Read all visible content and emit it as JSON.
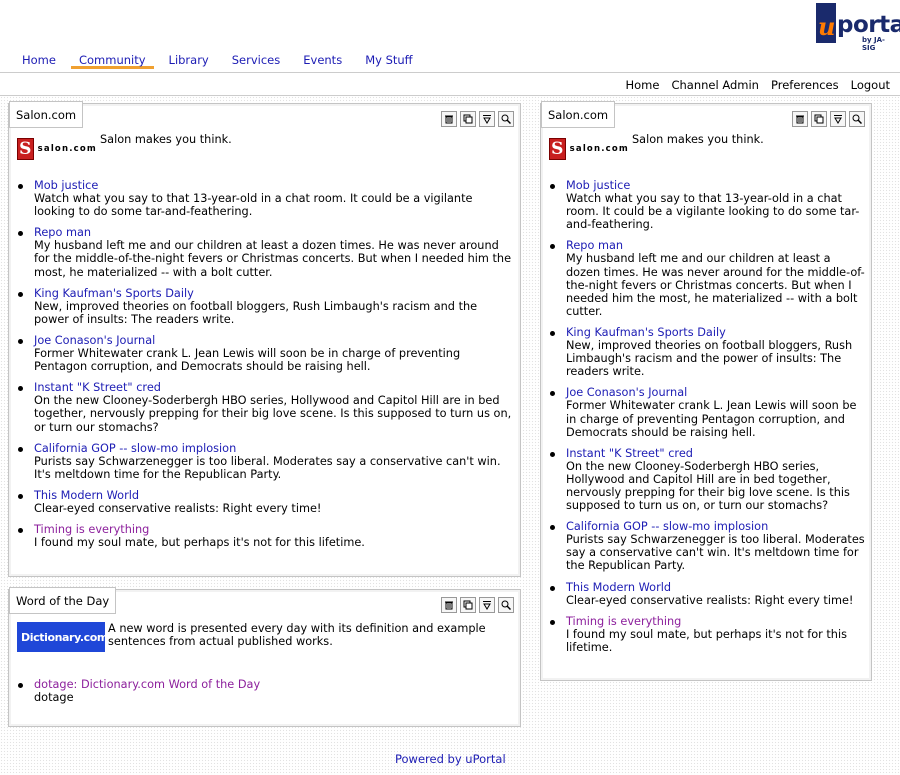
{
  "logo": {
    "u": "u",
    "portal": "portal",
    "byline": "by JA-SIG"
  },
  "tabs": [
    {
      "label": "Home",
      "active": false
    },
    {
      "label": "Community",
      "active": true
    },
    {
      "label": "Library",
      "active": false
    },
    {
      "label": "Services",
      "active": false
    },
    {
      "label": "Events",
      "active": false
    },
    {
      "label": "My Stuff",
      "active": false
    }
  ],
  "subnav": [
    "Home",
    "Channel Admin",
    "Preferences",
    "Logout"
  ],
  "colors": {
    "link": "#1c1cb4",
    "visited": "#8c1f9c",
    "active_tab_underline": "#f0a030"
  },
  "icons": [
    "trash-icon",
    "detach-icon",
    "minimize-icon",
    "zoom-icon"
  ],
  "salon": {
    "title": "Salon.com",
    "logo_text": "salon.com",
    "intro": "Salon makes you think.",
    "items": [
      {
        "title": "Mob justice",
        "desc": "Watch what you say to that 13-year-old in a chat room. It could be a vigilante looking to do some tar-and-feathering."
      },
      {
        "title": "Repo man",
        "desc": "My husband left me and our children at least a dozen times. He was never around for the middle-of-the-night fevers or Christmas concerts. But when I needed him the most, he materialized -- with a bolt cutter."
      },
      {
        "title": "King Kaufman's Sports Daily",
        "desc": "New, improved theories on football bloggers, Rush Limbaugh's racism and the power of insults: The readers write."
      },
      {
        "title": "Joe Conason's Journal",
        "desc": "Former Whitewater crank L. Jean Lewis will soon be in charge of preventing Pentagon corruption, and Democrats should be raising hell."
      },
      {
        "title": "Instant \"K Street\" cred",
        "desc": "On the new Clooney-Soderbergh HBO series, Hollywood and Capitol Hill are in bed together, nervously prepping for their big love scene. Is this supposed to turn us on, or turn our stomachs?"
      },
      {
        "title": "California GOP -- slow-mo implosion",
        "desc": "Purists say Schwarzenegger is too liberal. Moderates say a conservative can't win. It's meltdown time for the Republican Party."
      },
      {
        "title": "This Modern World",
        "desc": "Clear-eyed conservative realists: Right every time!"
      },
      {
        "title": "Timing is everything",
        "desc": "I found my soul mate, but perhaps it's not for this lifetime.",
        "visited": true
      }
    ]
  },
  "word": {
    "title": "Word of the Day",
    "logo_text": "Dictionary.com",
    "intro": "A new word is presented every day with its definition and example sentences from actual published works.",
    "items": [
      {
        "title": "dotage: Dictionary.com Word of the Day",
        "desc": "dotage",
        "visited": true
      }
    ]
  },
  "footer": "Powered by uPortal"
}
